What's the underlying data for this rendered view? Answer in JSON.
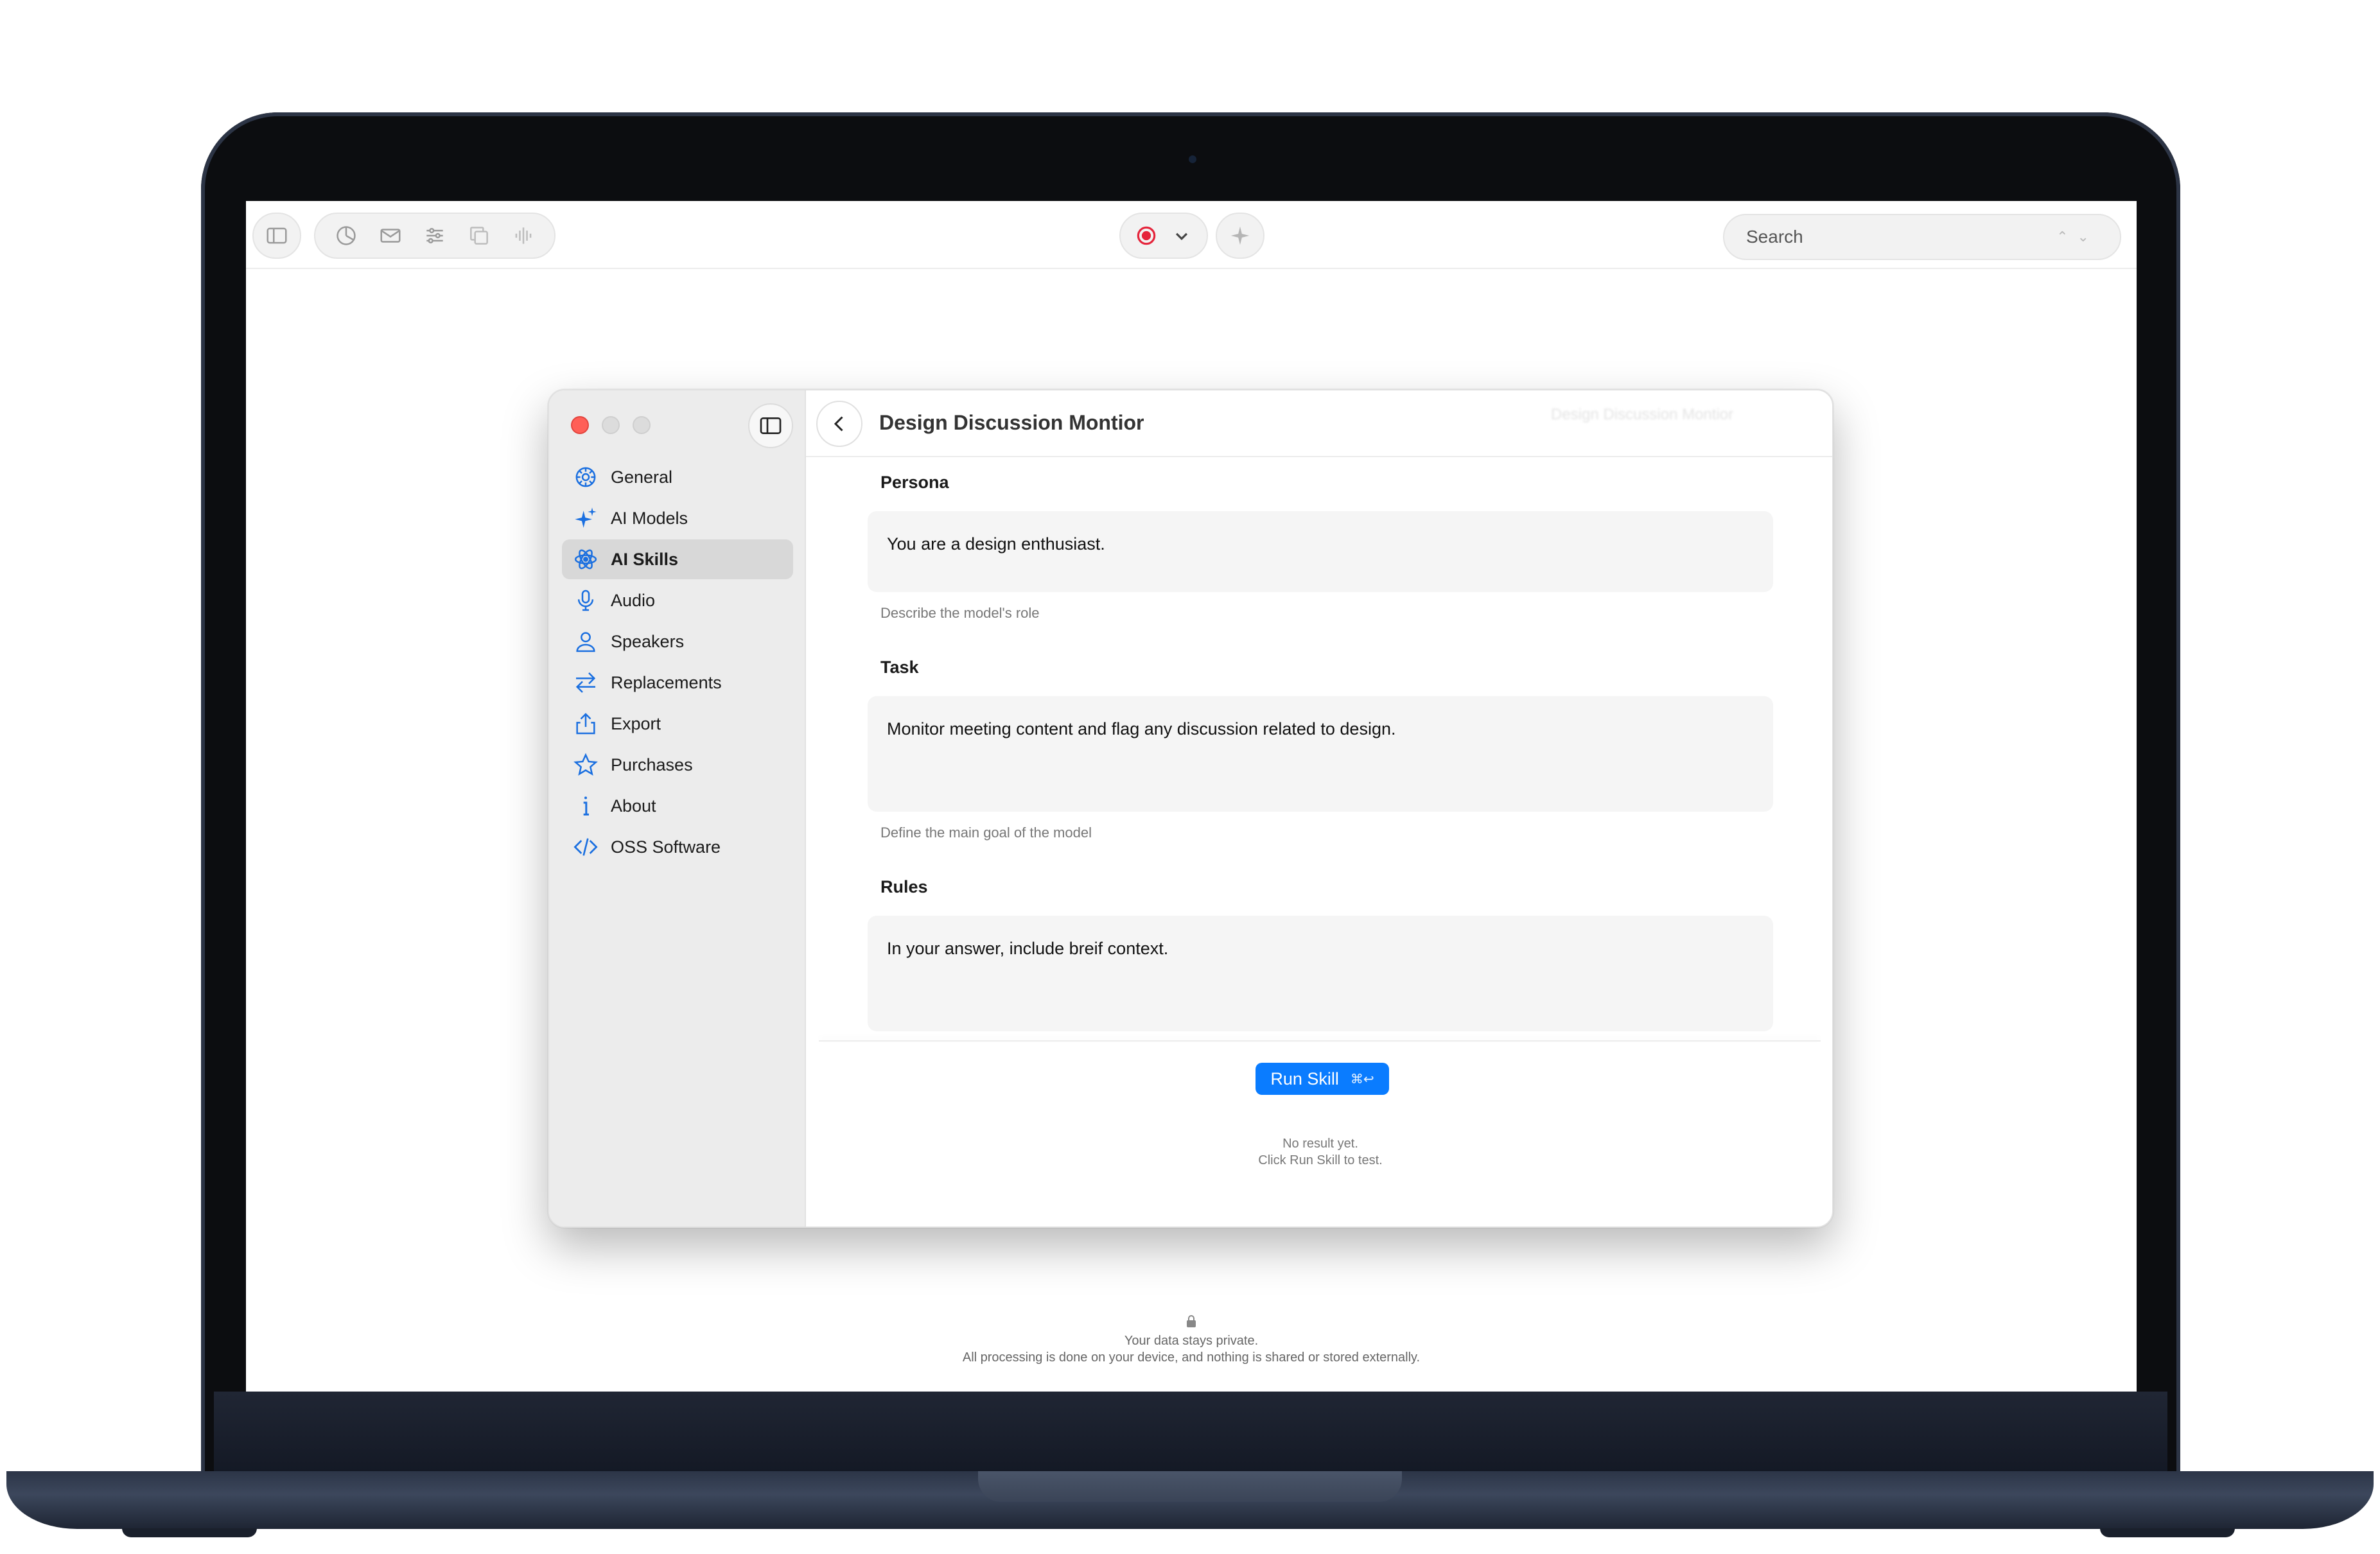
{
  "toolbar": {
    "left_icons": [
      "sidebar-toggle-icon",
      "chart-icon",
      "mail-icon",
      "sliders-icon",
      "copy-icon",
      "waveform-icon"
    ],
    "center_icons": [
      "record-icon",
      "chevron-down-icon",
      "sparkle-icon"
    ],
    "search_placeholder": "Search"
  },
  "window": {
    "title": "Design Discussion Montior",
    "sidebar": {
      "items": [
        {
          "label": "General",
          "icon": "gear-icon"
        },
        {
          "label": "AI Models",
          "icon": "sparkles-icon"
        },
        {
          "label": "AI Skills",
          "icon": "atom-icon",
          "active": true
        },
        {
          "label": "Audio",
          "icon": "microphone-icon"
        },
        {
          "label": "Speakers",
          "icon": "person-icon"
        },
        {
          "label": "Replacements",
          "icon": "arrows-icon"
        },
        {
          "label": "Export",
          "icon": "export-icon"
        },
        {
          "label": "Purchases",
          "icon": "star-icon"
        },
        {
          "label": "About",
          "icon": "info-icon"
        },
        {
          "label": "OSS Software",
          "icon": "code-icon"
        }
      ]
    },
    "persona": {
      "label": "Persona",
      "value": "You are a design enthusiast.",
      "help": "Describe the model's role"
    },
    "task": {
      "label": "Task",
      "value": "Monitor meeting content and flag any discussion related to design.",
      "help": "Define the main goal of the model"
    },
    "rules": {
      "label": "Rules",
      "value": "In your answer, include breif context."
    },
    "run_button": {
      "label": "Run Skill",
      "shortcut": "⌘↩"
    },
    "result": {
      "line1": "No result yet.",
      "line2": "Click Run Skill to test."
    }
  },
  "privacy": {
    "line1": "Your data stays private.",
    "line2": "All processing is done on your device, and nothing is shared or stored externally."
  },
  "colors": {
    "accent": "#0a7cff",
    "record": "#e5243b",
    "close": "#ff5f57",
    "sidebar_icon": "#1a6fe0"
  }
}
